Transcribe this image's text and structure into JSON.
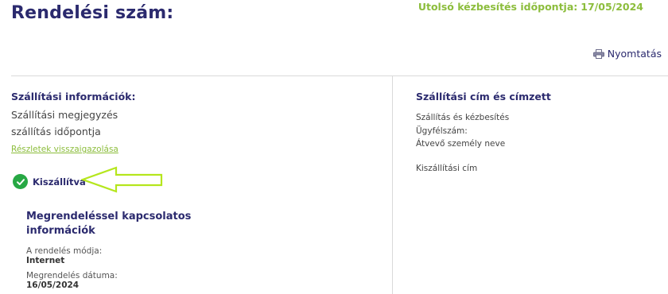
{
  "header": {
    "title": "Rendelési szám:",
    "last_delivery_label": "Utolsó kézbesítés időpontja:",
    "last_delivery_value": "17/05/2024",
    "print_label": "Nyomtatás"
  },
  "shipping_info": {
    "title": "Szállítási információk:",
    "note": "Szállítási megjegyzés",
    "time": "szállítás időpontja",
    "details_link": "Részletek visszaigazolása"
  },
  "status": {
    "label": "Kiszállítva",
    "color": "#27a844"
  },
  "order_info": {
    "title_line1": "Megrendeléssel kapcsolatos",
    "title_line2": "információk",
    "method_label": "A rendelés módja:",
    "method_value": "Internet",
    "date_label": "Megrendelés dátuma:",
    "date_value": "16/05/2024"
  },
  "recipient": {
    "title": "Szállítási cím és címzett",
    "delivery": "Szállítás és kézbesítés",
    "customer_no": "Ügyfélszám:",
    "receiver": "Átvevő személy neve",
    "address": "Kiszállítási cím"
  },
  "colors": {
    "brand_navy": "#2b2a6e",
    "accent_green": "#8cbd3c",
    "success": "#27a844",
    "annotation_arrow": "#b5e61d"
  },
  "icons": {
    "print": "printer-icon",
    "status": "check-circle-icon",
    "annotation": "arrow-left-icon"
  }
}
